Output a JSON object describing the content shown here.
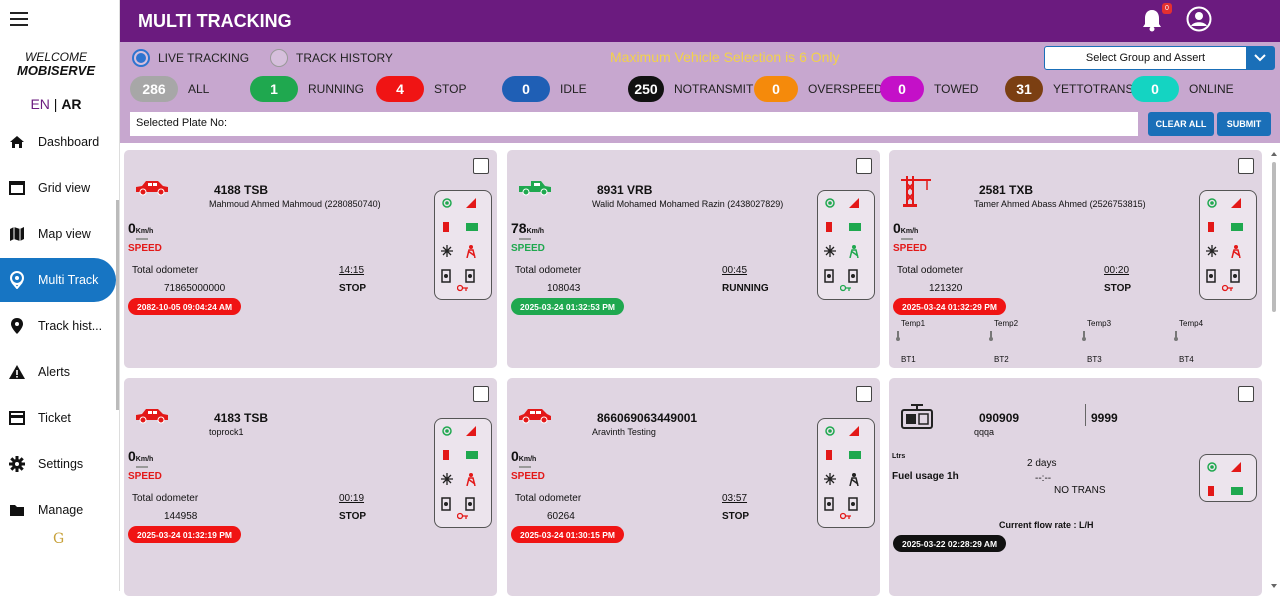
{
  "sidebar": {
    "welcome": "WELCOME",
    "username": "MOBISERVE",
    "lang_en": "EN",
    "lang_sep": "|",
    "lang_ar": "AR",
    "items": [
      {
        "label": "Dashboard",
        "icon": "home-icon"
      },
      {
        "label": "Grid view",
        "icon": "window-icon"
      },
      {
        "label": "Map view",
        "icon": "map-icon"
      },
      {
        "label": "Multi Track",
        "icon": "location-icon",
        "active": true
      },
      {
        "label": "Track hist...",
        "icon": "pin-icon"
      },
      {
        "label": "Alerts",
        "icon": "warning-icon"
      },
      {
        "label": "Ticket",
        "icon": "ticket-icon"
      },
      {
        "label": "Settings",
        "icon": "gear-icon"
      },
      {
        "label": "Manage",
        "icon": "folder-icon"
      }
    ]
  },
  "header": {
    "title": "MULTI TRACKING",
    "notification_count": "0"
  },
  "topbar": {
    "live_tracking": "LIVE TRACKING",
    "track_history": "TRACK HISTORY",
    "max_msg": "Maximum Vehicle Selection is 6 Only",
    "select_placeholder": "Select Group and Assert",
    "plate_label": "Selected Plate No:",
    "clear_all": "CLEAR ALL",
    "submit": "SUBMIT"
  },
  "stats": [
    {
      "count": "286",
      "label": "ALL",
      "color": "#a7a7a7"
    },
    {
      "count": "1",
      "label": "RUNNING",
      "color": "#1fa84f"
    },
    {
      "count": "4",
      "label": "STOP",
      "color": "#f01414"
    },
    {
      "count": "0",
      "label": "IDLE",
      "color": "#1f5fb5"
    },
    {
      "count": "250",
      "label": "NOTRANSMIT",
      "color": "#111111"
    },
    {
      "count": "0",
      "label": "OVERSPEED",
      "color": "#f58a0b"
    },
    {
      "count": "0",
      "label": "TOWED",
      "color": "#c410c8"
    },
    {
      "count": "31",
      "label": "YETTOTRANS",
      "color": "#7b3f12"
    },
    {
      "count": "0",
      "label": "ONLINE",
      "color": "#14d4c2"
    }
  ],
  "cards": [
    {
      "plate": "4188 TSB",
      "driver": "Mahmoud Ahmed Mahmoud (2280850740)",
      "speed": "0",
      "unit": "Km/h",
      "speed_label": "SPEED",
      "odo_label": "Total odometer",
      "odo": "71865000000",
      "time": "14:15",
      "status": "STOP",
      "timestamp": "2082-10-05 09:04:24 AM",
      "ts_color": "#f01414",
      "vcolor": "#e31818"
    },
    {
      "plate": "8931 VRB",
      "driver": "Walid Mohamed Mohamed Razin (2438027829)",
      "speed": "78",
      "unit": "Km/h",
      "speed_label": "SPEED",
      "odo_label": "Total odometer",
      "odo": "108043",
      "time": "00:45",
      "status": "RUNNING",
      "timestamp": "2025-03-24 01:32:53 PM",
      "ts_color": "#1fa84f",
      "vcolor": "#1fa84f"
    },
    {
      "plate": "2581 TXB",
      "driver": "Tamer Ahmed Abass Ahmed (2526753815)",
      "speed": "0",
      "unit": "Km/h",
      "speed_label": "SPEED",
      "odo_label": "Total odometer",
      "odo": "121320",
      "time": "00:20",
      "status": "STOP",
      "timestamp": "2025-03-24 01:32:29 PM",
      "ts_color": "#f01414",
      "vcolor": "#e31818",
      "temps": [
        "Temp1",
        "Temp2",
        "Temp3",
        "Temp4"
      ],
      "bts": [
        "BT1",
        "BT2",
        "BT3",
        "BT4"
      ]
    },
    {
      "plate": "4183 TSB",
      "driver": "toprock1",
      "speed": "0",
      "unit": "Km/h",
      "speed_label": "SPEED",
      "odo_label": "Total odometer",
      "odo": "144958",
      "time": "00:19",
      "status": "STOP",
      "timestamp": "2025-03-24 01:32:19 PM",
      "ts_color": "#f01414",
      "vcolor": "#e31818"
    },
    {
      "plate": "866069063449001",
      "driver": "Aravinth Testing",
      "speed": "0",
      "unit": "Km/h",
      "speed_label": "SPEED",
      "odo_label": "Total odometer",
      "odo": "60264",
      "time": "03:57",
      "status": "STOP",
      "timestamp": "2025-03-24 01:30:15 PM",
      "ts_color": "#f01414",
      "vcolor": "#e31818"
    },
    {
      "plate": "090909",
      "driver": "qqqa",
      "extra": "9999",
      "ltrs": "Ltrs",
      "fuel_label": "Fuel usage 1h",
      "fuel_value": "2 days",
      "fuel_dash": "--:--",
      "status": "NO TRANS",
      "flow": "Current flow rate : L/H",
      "timestamp": "2025-03-22 02:28:29 AM",
      "ts_color": "#111111"
    }
  ]
}
